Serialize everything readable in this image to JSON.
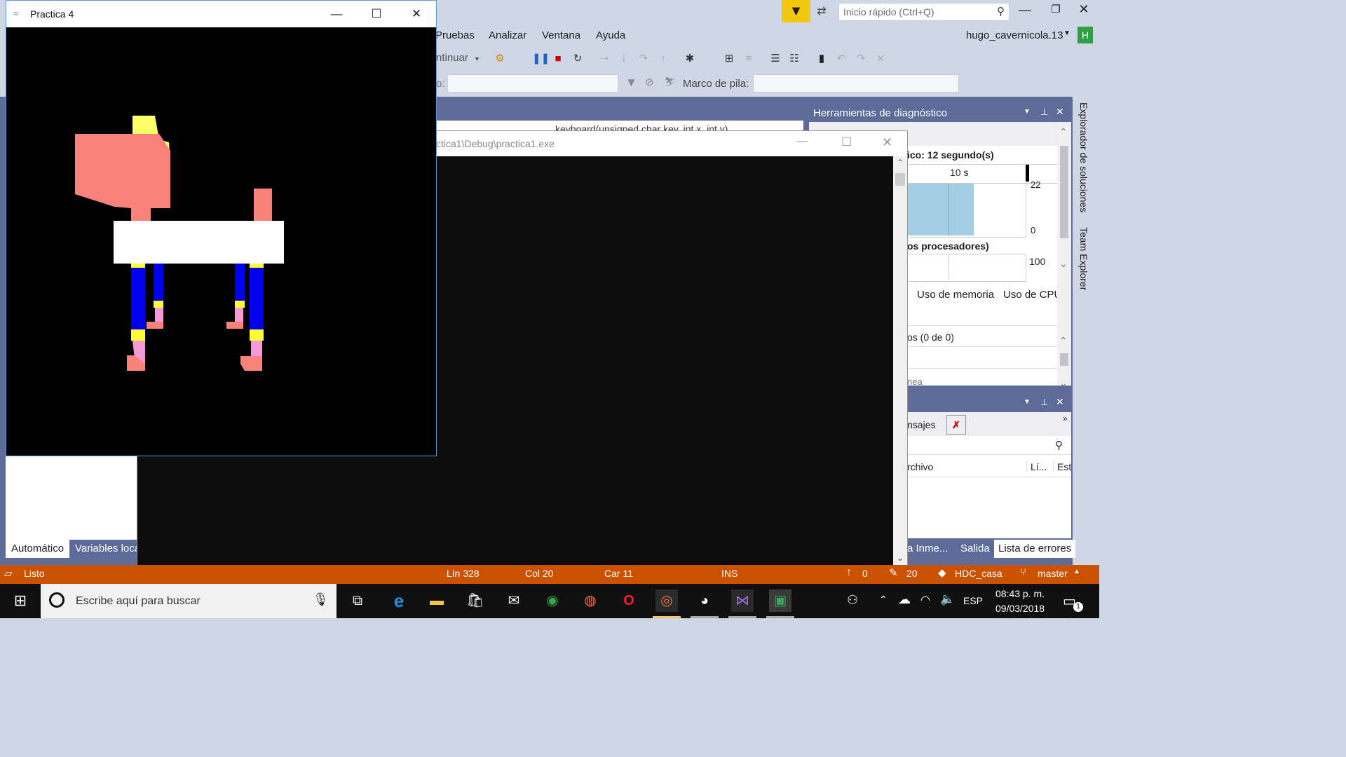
{
  "vs": {
    "menu": [
      "Pruebas",
      "Analizar",
      "Ventana",
      "Ayuda"
    ],
    "quick_launch_placeholder": "Inicio rápido (Ctrl+Q)",
    "user": "hugo_cavernicola.13",
    "user_initial": "H",
    "toolbar_continue": "ntinuar",
    "toolbar_process_label": "o:",
    "stack_frame_label": "Marco de pila:",
    "editor_path": "ctica1\\Debug\\practica1.exe",
    "function_dropdown": "keyboard(unsigned char key, int x, int y)",
    "side_tabs": [
      "Explorador de soluciones",
      "Team Explorer"
    ],
    "left_tabs": [
      "Automático",
      "Variables loca"
    ],
    "bottom_tabs": [
      "a Inme...",
      "Salida",
      "Lista de errores"
    ]
  },
  "diag": {
    "title": "Herramientas de diagnóstico",
    "session_label": "ico: 12 segundo(s)",
    "timeline_tick": "10 s",
    "graph1_top": "22",
    "graph1_bottom": "0",
    "cpu_label": "os procesadores)",
    "cpu_value": "100",
    "tabs": [
      "Uso de memoria",
      "Uso de CPU"
    ],
    "events_count": "os (0 de 0)",
    "partial_label": "nea"
  },
  "errors": {
    "tab_label": "nsajes",
    "col_file": "rchivo",
    "col_line": "Lí...",
    "col_state": "Est"
  },
  "practica": {
    "title": "Practica 4"
  },
  "console": {
    "title": "ctica1\\Debug\\practica1.exe"
  },
  "status": {
    "ready": "Listo",
    "line": "Lín 328",
    "col": "Col 20",
    "car": "Car 11",
    "ins": "INS",
    "up_count": "0",
    "pencil_count": "20",
    "repo": "HDC_casa",
    "branch": "master"
  },
  "taskbar": {
    "search_placeholder": "Escribe aquí para buscar",
    "lang": "ESP",
    "time": "08:43 p. m.",
    "date": "09/03/2018",
    "notif_count": "1"
  },
  "colors": {
    "vs_bg": "#CFD6E5",
    "status_orange": "#CA5100",
    "accent_green": "#2EA043",
    "figure_salmon": "#F9837A",
    "figure_blue": "#0000EE",
    "figure_yellow": "#FFFF66",
    "figure_pink": "#F49AD8"
  }
}
